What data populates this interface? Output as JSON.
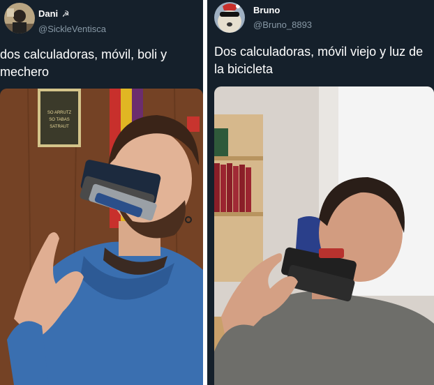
{
  "tweets": [
    {
      "display_name": "Dani",
      "name_symbol": "☭",
      "handle": "@SickleVentisca",
      "text": "dos calculadoras, móvil, boli y\nmechero",
      "avatar_icon": "user-avatar-icon",
      "poster_text": "SO ARRUTZ\nSO TABAS\nSATRAUT"
    },
    {
      "display_name": "Bruno",
      "handle": "@Bruno_8893",
      "text": "Dos calculadoras, móvil viejo y luz de\nla bicicleta",
      "avatar_icon": "dog-avatar-icon"
    }
  ],
  "colors": {
    "background": "#15202b",
    "text": "#ffffff",
    "secondary_text": "#8899a6"
  }
}
